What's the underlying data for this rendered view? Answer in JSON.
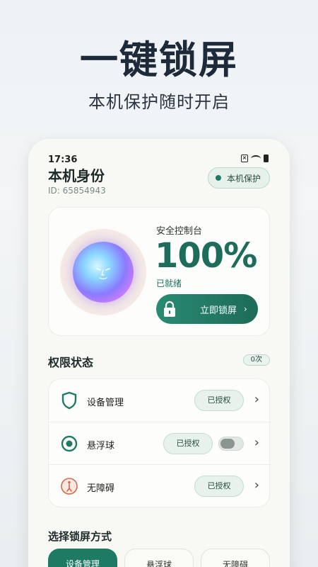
{
  "promo": {
    "headline": "一键锁屏",
    "subline": "本机保护随时开启"
  },
  "status_bar": {
    "time": "17:36",
    "icons": [
      "notification-x-icon",
      "wifi-icon",
      "battery-icon"
    ]
  },
  "identity": {
    "title": "本机身份",
    "id_label": "ID: 65854943",
    "protect_button": "本机保护"
  },
  "console": {
    "label": "安全控制台",
    "percent": "100%",
    "status": "已就绪",
    "lock_button": "立即锁屏",
    "lock_chevron": "›"
  },
  "permissions": {
    "title": "权限状态",
    "count_badge": "0次",
    "items": [
      {
        "label": "设备管理",
        "button": "已授权",
        "icon": "shield-icon",
        "toggle": false
      },
      {
        "label": "悬浮球",
        "button": "已授权",
        "icon": "floating-ball-icon",
        "toggle": true,
        "toggle_on": false
      },
      {
        "label": "无障碍",
        "button": "已授权",
        "icon": "accessibility-icon",
        "toggle": false
      }
    ],
    "chevron": "›"
  },
  "lock_mode": {
    "title": "选择锁屏方式",
    "tabs": [
      {
        "label": "设备管理",
        "active": true
      },
      {
        "label": "悬浮球",
        "active": false
      },
      {
        "label": "无障碍",
        "active": false
      }
    ]
  },
  "colors": {
    "accent": "#1f7a64",
    "accent_light": "#e7f2ec",
    "headline": "#1d2a3a"
  }
}
